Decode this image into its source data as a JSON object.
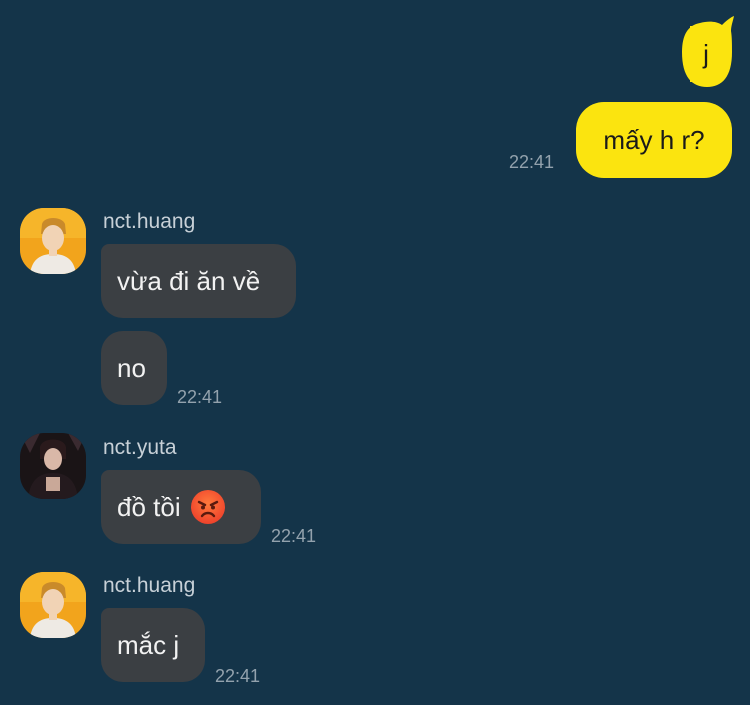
{
  "messages": {
    "m1": {
      "text": "j"
    },
    "m2": {
      "text": "mấy h r?",
      "time": "22:41"
    },
    "m3": {
      "sender": "nct.huang",
      "text": "vừa đi ăn về"
    },
    "m4": {
      "text": "no",
      "time": "22:41"
    },
    "m5": {
      "sender": "nct.yuta",
      "text": "đồ tồi",
      "time": "22:41",
      "emoji": "angry-face-emoji"
    },
    "m6": {
      "sender": "nct.huang",
      "text": "mắc j",
      "time": "22:41"
    }
  },
  "colors": {
    "background": "#143449",
    "outgoing_bubble": "#fbe40f",
    "incoming_bubble": "#3b3f43",
    "timestamp": "#93a2ad"
  }
}
